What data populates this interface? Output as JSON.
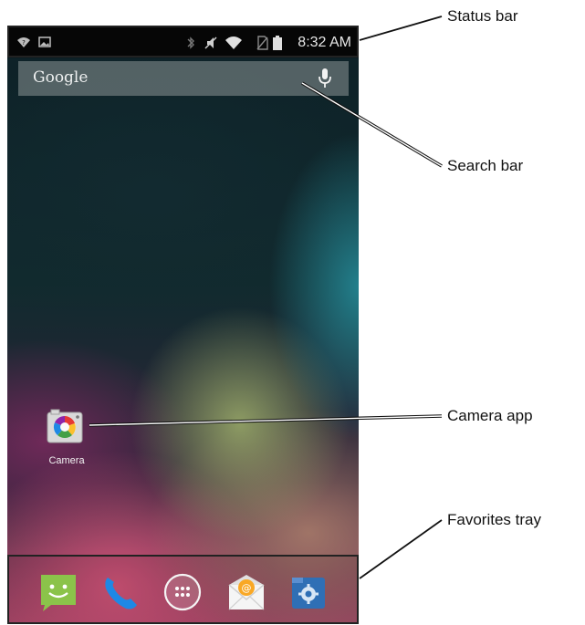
{
  "status_bar": {
    "time": "8:32 AM",
    "icons": [
      "wifi-question-icon",
      "image-notification-icon",
      "bluetooth-icon",
      "mute-icon",
      "wifi-icon",
      "no-sim-icon",
      "battery-icon"
    ]
  },
  "search_bar": {
    "brand": "Google",
    "icon": "mic-icon"
  },
  "apps": {
    "camera": {
      "label": "Camera",
      "icon": "camera-icon"
    }
  },
  "favorites_tray": {
    "items": [
      {
        "icon": "messaging-icon"
      },
      {
        "icon": "phone-icon"
      },
      {
        "icon": "app-drawer-icon"
      },
      {
        "icon": "email-icon"
      },
      {
        "icon": "settings-icon"
      }
    ]
  },
  "callouts": {
    "status_bar": "Status bar",
    "search_bar": "Search bar",
    "camera_app": "Camera app",
    "favorites_tray": "Favorites tray"
  },
  "colors": {
    "status_bar_bg": "#060606",
    "tray_border": "#222222",
    "messaging_green": "#8bc34a",
    "phone_blue": "#1e88e5",
    "settings_blue": "#2f6fb5"
  }
}
